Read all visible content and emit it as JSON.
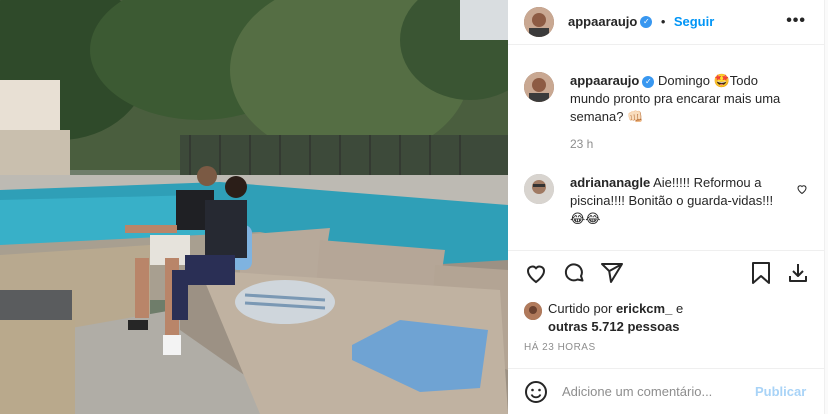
{
  "post": {
    "author": "appaaraujo",
    "follow_label": "Seguir",
    "more_label": "•••",
    "caption_username": "appaaraujo",
    "caption_text": "Domingo 🤩Todo mundo pronto pra encarar mais uma semana? 👊🏻",
    "caption_time": "23 h",
    "comment": {
      "username": "adriananagle",
      "text": "Aie!!!!! Reformou a piscina!!!! Bonitão o guarda-vidas!!!😂😂"
    },
    "liked_by_prefix": "Curtido por",
    "liked_by_user": "erickcm_",
    "liked_by_and": "e",
    "others_text": "outras 5.712 pessoas",
    "time_ago": "HÁ 23 HORAS",
    "add_comment_placeholder": "Adicione um comentário...",
    "publish_label": "Publicar"
  },
  "icons": [
    "heart-icon",
    "comment-icon",
    "share-icon",
    "bookmark-icon",
    "download-icon",
    "emoji-icon",
    "verified-icon",
    "more-icon"
  ],
  "colors": {
    "link": "#0095f6",
    "publish_disabled": "#a8d3f7",
    "verified": "#3897f0",
    "muted": "#8e8e8e"
  }
}
